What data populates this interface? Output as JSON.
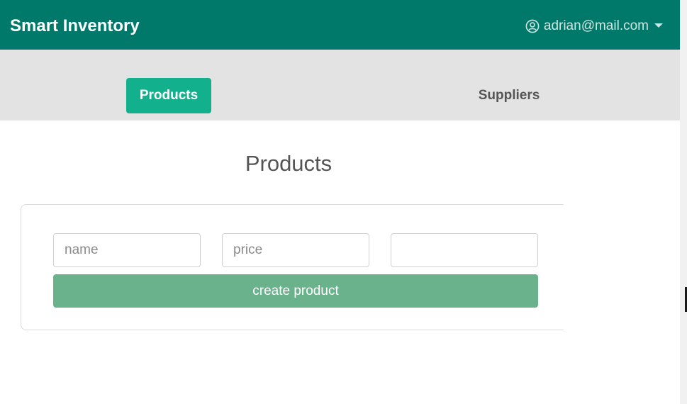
{
  "app": {
    "brand": "Smart Inventory",
    "user_email": "adrian@mail.com",
    "user_icon": "user-circle-icon",
    "menu_icon": "caret-down-icon"
  },
  "nav": {
    "tabs": [
      {
        "label": "Products",
        "active": true
      },
      {
        "label": "Suppliers",
        "active": false
      }
    ]
  },
  "main": {
    "title": "Products",
    "form": {
      "name_placeholder": "name",
      "price_placeholder": "price",
      "third_placeholder": "",
      "submit_label": "create product"
    }
  },
  "colors": {
    "topbar": "#00796b",
    "subnav": "#e3e3e3",
    "active_tab": "#13b08e",
    "submit_button": "#69b28b"
  }
}
